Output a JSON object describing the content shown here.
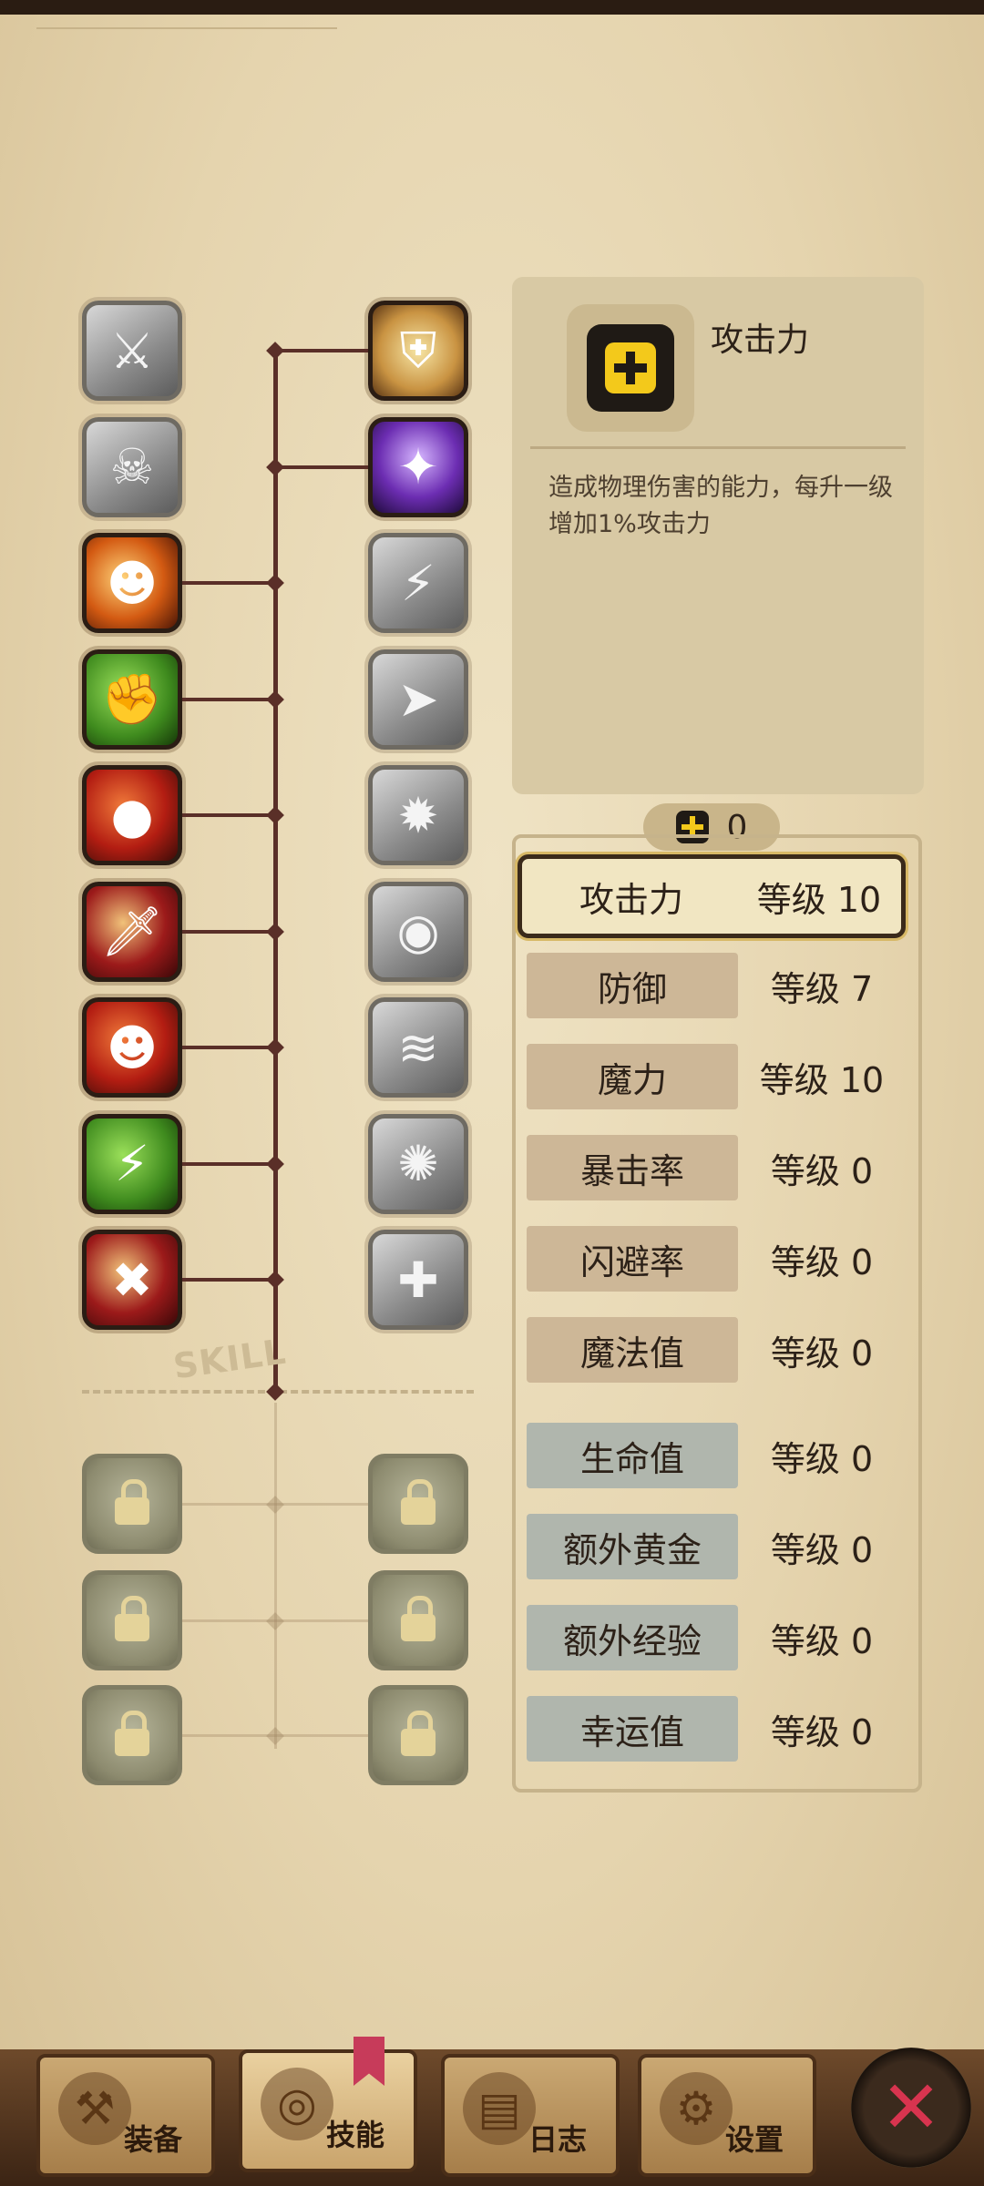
{
  "left_column_icons": [
    {
      "name": "slash-icon",
      "state": "gray",
      "glyph": "⚔"
    },
    {
      "name": "bone-icon",
      "state": "gray",
      "glyph": "☠"
    },
    {
      "name": "rage-icon",
      "state": "fire",
      "glyph": "☻"
    },
    {
      "name": "muscle-icon",
      "state": "green",
      "glyph": "✊"
    },
    {
      "name": "punch-icon",
      "state": "red",
      "glyph": "●"
    },
    {
      "name": "dagger-icon",
      "state": "crimson",
      "glyph": "🗡"
    },
    {
      "name": "ninja-icon",
      "state": "red",
      "glyph": "☻"
    },
    {
      "name": "lightning-icon",
      "state": "green",
      "glyph": "⚡"
    },
    {
      "name": "crossed-swords-icon",
      "state": "crimson",
      "glyph": "✖"
    }
  ],
  "right_column_icons": [
    {
      "name": "shield-icon",
      "state": "gold",
      "glyph": "⛨"
    },
    {
      "name": "magic-icon",
      "state": "purple",
      "glyph": "✦"
    },
    {
      "name": "thunder-icon",
      "state": "gray",
      "glyph": "⚡"
    },
    {
      "name": "charge-icon",
      "state": "gray",
      "glyph": "➤"
    },
    {
      "name": "smash-icon",
      "state": "gray",
      "glyph": "✹"
    },
    {
      "name": "eye-icon",
      "state": "gray",
      "glyph": "◉"
    },
    {
      "name": "wind-icon",
      "state": "gray",
      "glyph": "≋"
    },
    {
      "name": "cog-icon",
      "state": "gray",
      "glyph": "✺"
    },
    {
      "name": "sparkle-icon",
      "state": "gray",
      "glyph": "✚"
    }
  ],
  "skill_stamp": "SKILL",
  "info": {
    "title": "攻击力",
    "description": "造成物理伤害的能力，每升一级增加1%攻击力"
  },
  "points": "0",
  "stats": [
    {
      "name": "攻击力",
      "level": "等级 10",
      "style": "selected"
    },
    {
      "name": "防御",
      "level": "等级 7",
      "style": "brown"
    },
    {
      "name": "魔力",
      "level": "等级 10",
      "style": "brown"
    },
    {
      "name": "暴击率",
      "level": "等级 0",
      "style": "brown"
    },
    {
      "name": "闪避率",
      "level": "等级 0",
      "style": "brown"
    },
    {
      "name": "魔法值",
      "level": "等级 0",
      "style": "brown"
    },
    {
      "name": "生命值",
      "level": "等级 0",
      "style": "blue"
    },
    {
      "name": "额外黄金",
      "level": "等级 0",
      "style": "blue"
    },
    {
      "name": "额外经验",
      "level": "等级 0",
      "style": "blue"
    },
    {
      "name": "幸运值",
      "level": "等级 0",
      "style": "blue"
    }
  ],
  "nav": {
    "equipment": "装备",
    "skills": "技能",
    "log": "日志",
    "settings": "设置"
  },
  "close_glyph": "✕"
}
